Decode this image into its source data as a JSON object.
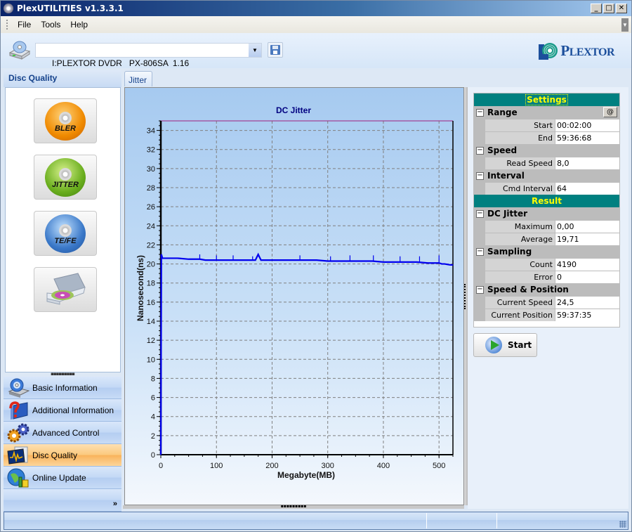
{
  "window": {
    "title": "PlexUTILITIES v1.3.3.1",
    "controls": {
      "minimize": "_",
      "maximize": "□",
      "close": "✕"
    }
  },
  "menu": [
    "File",
    "Tools",
    "Help"
  ],
  "toolbar": {
    "drive_value": "I:PLEXTOR DVDR   PX-806SA  1.16",
    "dropdown_glyph": "▼",
    "logo_text_big": "P",
    "logo_text_small": "LEXTOR"
  },
  "left_panel": {
    "header": "Disc Quality",
    "quality_buttons": [
      {
        "label": "BLER",
        "color": "#f08a00"
      },
      {
        "label": "JITTER",
        "color": "#6aae1e"
      },
      {
        "label": "TE/FE",
        "color": "#3a78c8"
      },
      {
        "label": "",
        "icon": "optical-drive"
      }
    ],
    "splitter_glyph": "▪▪▪▪▪▪▪▪▪",
    "nav": [
      {
        "label": "Basic Information",
        "icon": "drive-disc-icon",
        "active": false
      },
      {
        "label": "Additional Information",
        "icon": "help-book-icon",
        "active": false
      },
      {
        "label": "Advanced Control",
        "icon": "gears-icon",
        "active": false
      },
      {
        "label": "Disc Quality",
        "icon": "monitor-graph-icon",
        "active": true
      },
      {
        "label": "Online Update",
        "icon": "globe-update-icon",
        "active": false
      }
    ],
    "more_glyph": "»"
  },
  "tabs": [
    {
      "label": "Jitter",
      "active": true
    }
  ],
  "chart_data": {
    "type": "line",
    "title": "DC Jitter",
    "xlabel": "Megabyte(MB)",
    "ylabel": "Nanosecond(ns)",
    "xlim": [
      0,
      525
    ],
    "ylim": [
      0,
      35
    ],
    "xticks": [
      0,
      100,
      200,
      300,
      400,
      500
    ],
    "yticks": [
      0,
      2,
      4,
      6,
      8,
      10,
      12,
      14,
      16,
      18,
      20,
      22,
      24,
      26,
      28,
      30,
      32,
      34
    ],
    "grid": true,
    "series": [
      {
        "name": "DC Jitter",
        "color": "#0000ee",
        "x": [
          0,
          1,
          3,
          5,
          15,
          30,
          50,
          60,
          70,
          80,
          100,
          120,
          140,
          160,
          170,
          175,
          180,
          190,
          200,
          220,
          250,
          280,
          300,
          320,
          340,
          360,
          380,
          400,
          420,
          440,
          460,
          480,
          490,
          500,
          505,
          510,
          520,
          525
        ],
        "y": [
          0,
          21.0,
          20.6,
          20.6,
          20.6,
          20.6,
          20.5,
          20.5,
          20.5,
          20.4,
          20.4,
          20.4,
          20.4,
          20.4,
          20.4,
          21.0,
          20.4,
          20.4,
          20.4,
          20.4,
          20.4,
          20.4,
          20.3,
          20.3,
          20.3,
          20.3,
          20.3,
          20.2,
          20.2,
          20.2,
          20.2,
          20.1,
          20.1,
          20.1,
          20.0,
          20.0,
          19.9,
          19.9
        ]
      }
    ],
    "spikes": [
      {
        "x": 70,
        "y": 21.0
      },
      {
        "x": 100,
        "y": 20.9
      },
      {
        "x": 130,
        "y": 20.9
      },
      {
        "x": 165,
        "y": 20.8
      },
      {
        "x": 250,
        "y": 20.9
      },
      {
        "x": 305,
        "y": 20.8
      },
      {
        "x": 340,
        "y": 20.9
      },
      {
        "x": 382,
        "y": 20.9
      },
      {
        "x": 430,
        "y": 20.8
      },
      {
        "x": 465,
        "y": 20.8
      },
      {
        "x": 500,
        "y": 20.9
      }
    ]
  },
  "settings": {
    "header": "Settings",
    "at_button": "@",
    "groups": [
      {
        "name": "Range",
        "rows": [
          {
            "key": "Start",
            "value": "00:02:00"
          },
          {
            "key": "End",
            "value": "59:36:68"
          }
        ]
      },
      {
        "name": "Speed",
        "rows": [
          {
            "key": "Read Speed",
            "value": "8,0"
          }
        ]
      },
      {
        "name": "Interval",
        "rows": [
          {
            "key": "Cmd Interval",
            "value": "64"
          }
        ]
      }
    ]
  },
  "result": {
    "header": "Result",
    "groups": [
      {
        "name": "DC Jitter",
        "rows": [
          {
            "key": "Maximum",
            "value": "0,00"
          },
          {
            "key": "Average",
            "value": "19,71"
          }
        ]
      },
      {
        "name": "Sampling",
        "rows": [
          {
            "key": "Count",
            "value": "4190"
          },
          {
            "key": "Error",
            "value": "0"
          }
        ]
      },
      {
        "name": "Speed & Position",
        "rows": [
          {
            "key": "Current Speed",
            "value": "24,5"
          },
          {
            "key": "Current Position",
            "value": "59:37:35"
          }
        ]
      }
    ]
  },
  "start_button": "Start",
  "toggle_glyph": "−"
}
